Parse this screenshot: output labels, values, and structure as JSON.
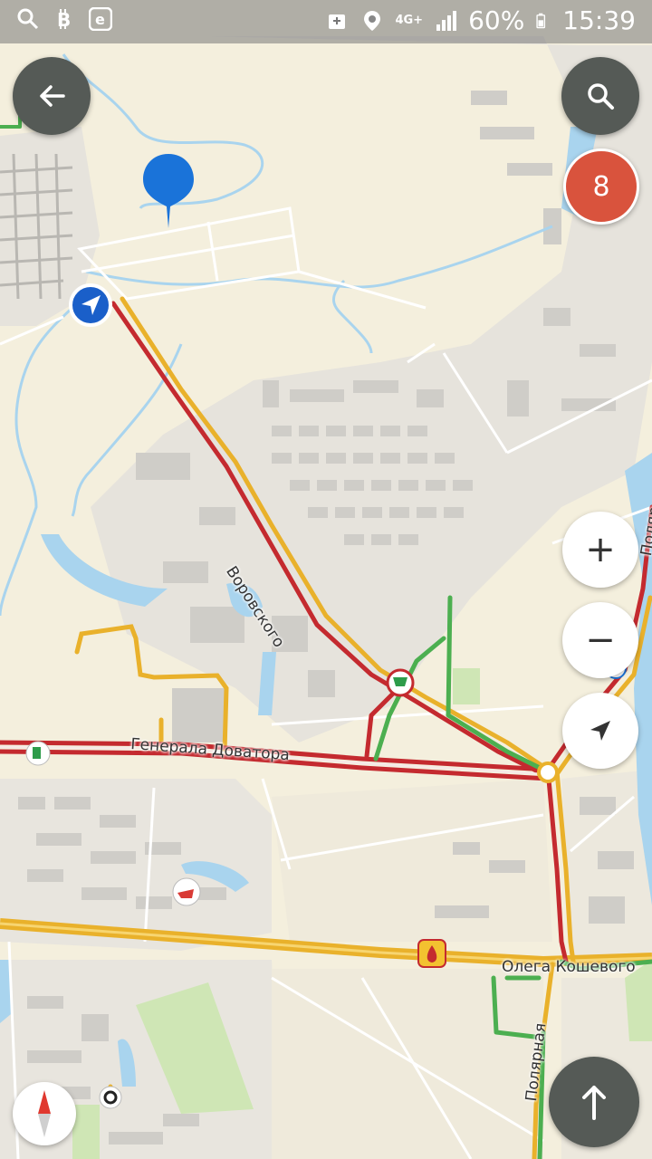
{
  "status_bar": {
    "left_icons": [
      "search-icon",
      "bitcoin-icon",
      "e-app-icon"
    ],
    "right_icons": [
      "package-icon",
      "location-pin-icon",
      "signal-icon",
      "battery-icon"
    ],
    "network": "4G+",
    "battery": "60%",
    "time": "15:39"
  },
  "controls": {
    "back_icon": "back-arrow-icon",
    "search_icon": "search-icon",
    "traffic_level": "8",
    "zoom_in": "+",
    "zoom_out": "−",
    "locate_icon": "locate-arrow-icon",
    "compass_icon": "compass-icon",
    "route_icon": "route-up-arrow-icon"
  },
  "streets": {
    "vorovskogo": "Воровского",
    "dovatora": "Генерала Доватора",
    "koshevogo": "Олега Кошевого",
    "polyarnaya": "Полярная",
    "polyarnaya_top": "Поляр"
  },
  "colors": {
    "traffic_red": "#c42a2f",
    "traffic_yellow": "#e9b12b",
    "traffic_green": "#4caf50",
    "water": "#a9d4ee",
    "pin_blue": "#1a73d9",
    "badge_red": "#d9533d"
  }
}
